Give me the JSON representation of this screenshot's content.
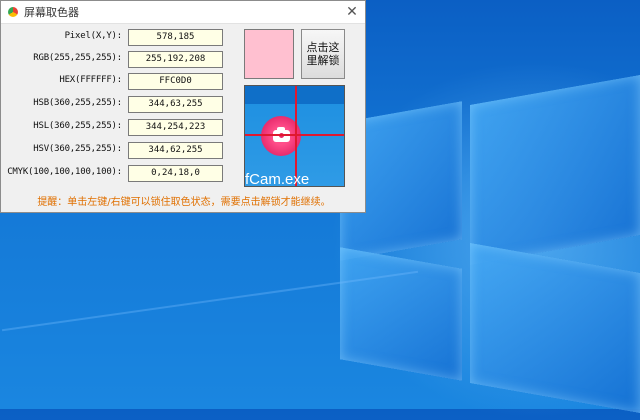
{
  "window": {
    "title": "屏幕取色器",
    "close_symbol": "✕"
  },
  "fields": [
    {
      "label": "Pixel(X,Y):",
      "value": "578,185"
    },
    {
      "label": "RGB(255,255,255):",
      "value": "255,192,208"
    },
    {
      "label": "HEX(FFFFFF):",
      "value": "FFC0D0"
    },
    {
      "label": "HSB(360,255,255):",
      "value": "344,63,255"
    },
    {
      "label": "HSL(360,255,255):",
      "value": "344,254,223"
    },
    {
      "label": "HSV(360,255,255):",
      "value": "344,62,255"
    },
    {
      "label": "CMYK(100,100,100,100):",
      "value": "0,24,18,0"
    }
  ],
  "swatch": {
    "color": "#FFC0D0"
  },
  "lock_button": {
    "line1": "点击这",
    "line2": "里解锁"
  },
  "magnifier": {
    "text": "fCam.exe",
    "crosshair_color": "#e0182f"
  },
  "tip": "提醒：单击左键/右键可以锁住取色状态，需要点击解锁才能继续。",
  "desktop": {
    "accent": "#1478d6"
  }
}
